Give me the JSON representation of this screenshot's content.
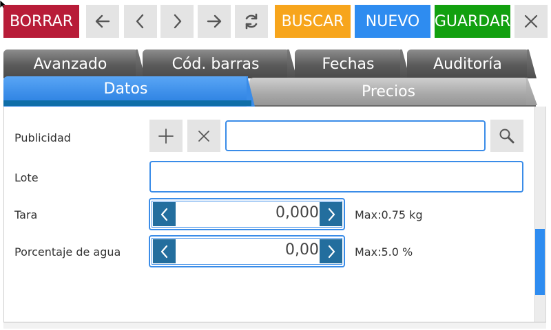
{
  "toolbar": {
    "delete_label": "BORRAR",
    "search_label": "BUSCAR",
    "new_label": "NUEVO",
    "save_label": "GUARDAR",
    "icons": [
      "arrow-left-icon",
      "chevron-left-icon",
      "chevron-right-icon",
      "arrow-right-icon",
      "refresh-icon",
      "close-icon"
    ],
    "colors": {
      "delete": "#b81c38",
      "search": "#f7a51c",
      "new": "#2e8cf0",
      "save": "#12a00f"
    }
  },
  "tabs": {
    "back_row": [
      "Avanzado",
      "Cód. barras",
      "Fechas",
      "Auditoría"
    ],
    "front_row": [
      "Datos",
      "Precios"
    ],
    "active": "Datos"
  },
  "form": {
    "publicidad": {
      "label": "Publicidad",
      "value": ""
    },
    "lote": {
      "label": "Lote",
      "value": ""
    },
    "tara": {
      "label": "Tara",
      "value": "0,000",
      "hint": "Max:0.75 kg"
    },
    "agua": {
      "label": "Porcentaje de agua",
      "value": "0,00",
      "hint": "Max:5.0 %"
    }
  }
}
